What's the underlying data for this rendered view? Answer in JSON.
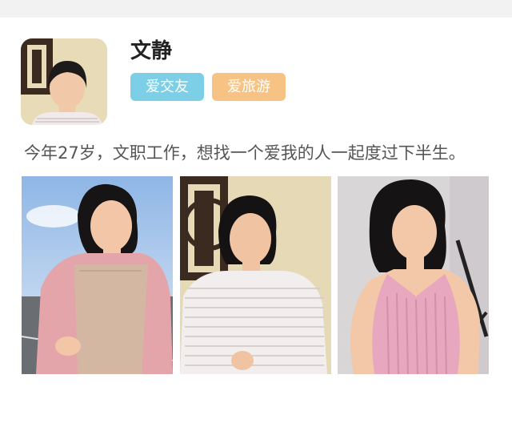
{
  "profile": {
    "name": "文静",
    "avatar_icon": "person-portrait-icon",
    "tags": [
      {
        "label": "爱交友",
        "color": "#7ccfe6"
      },
      {
        "label": "爱旅游",
        "color": "#f7c385"
      }
    ],
    "bio": "今年27岁，文职工作，想找一个爱我的人一起度过下半生。"
  },
  "gallery": {
    "photos": [
      {
        "icon": "photo-pink-cardigan-icon"
      },
      {
        "icon": "photo-striped-top-icon"
      },
      {
        "icon": "photo-pink-halter-icon"
      }
    ]
  }
}
